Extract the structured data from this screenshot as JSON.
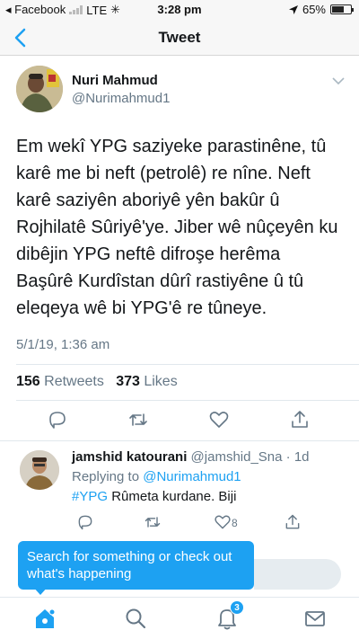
{
  "status_bar": {
    "carrier": "◂ Facebook",
    "network": "LTE",
    "time": "3:28 pm",
    "battery": "65%",
    "battery_level": 0.65
  },
  "nav": {
    "title": "Tweet"
  },
  "tweet": {
    "author_name": "Nuri Mahmud",
    "author_handle": "@Nurimahmud1",
    "text": "Em wekî YPG saziyeke parastinêne, tû\nkarê me bi neft (petrolê) re nîne. Neft\nkarê saziyên aboriyê yên bakûr û\nRojhilatê Sûriyê'ye. Jiber wê nûçeyên ku\ndibêjin YPG neftê difroşe herêma\nBaşûrê Kurdîstan dûrî rastiyêne û tû\neleqeya wê bi YPG'ê re tûneye.",
    "timestamp": "5/1/19, 1:36 am",
    "retweets_count": "156",
    "retweets_label": " Retweets",
    "likes_count": "373",
    "likes_label": " Likes"
  },
  "reply": {
    "name": "jamshid katourani",
    "handle": " @jamshid_Sna · 1d",
    "replying_prefix": "Replying to ",
    "replying_handle": "@Nurimahmud1",
    "hashtag": "#YPG",
    "text": " Rûmeta kurdane. Biji",
    "like_count": "8"
  },
  "tooltip": {
    "text": "Search for something or check out what's happening"
  },
  "tabbar": {
    "notifications_badge": "3"
  },
  "colors": {
    "accent": "#1da1f2",
    "secondary_text": "#657786",
    "primary_text": "#14171a"
  }
}
